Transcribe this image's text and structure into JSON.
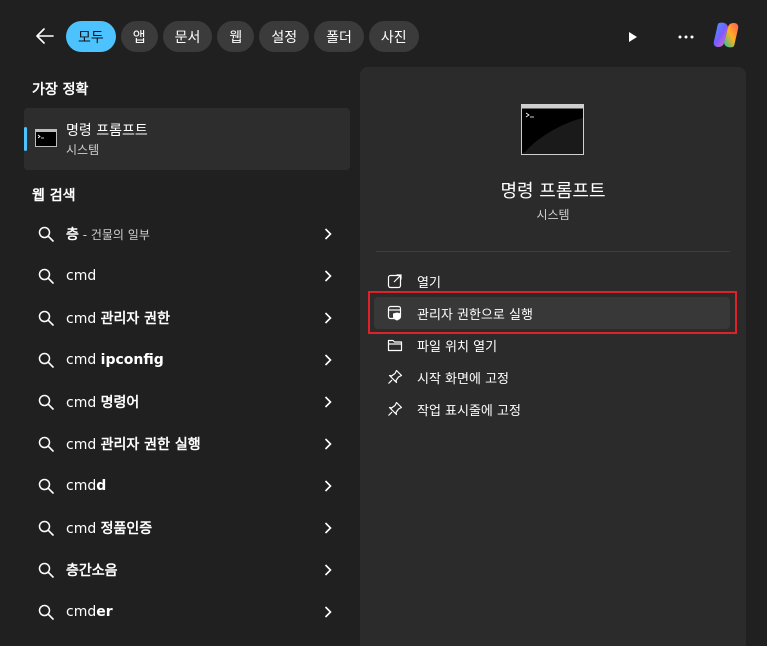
{
  "topbar": {
    "filters": [
      "모두",
      "앱",
      "문서",
      "웹",
      "설정",
      "폴더",
      "사진"
    ],
    "active_filter": "모두"
  },
  "best_match": {
    "heading": "가장 정확",
    "name": "명령 프롬프트",
    "type": "시스템"
  },
  "web_search": {
    "heading": "웹 검색",
    "items": [
      {
        "prefix": "",
        "bold": "층",
        "suffix": " - 건물의 일부"
      },
      {
        "prefix": "cmd",
        "bold": "",
        "suffix": ""
      },
      {
        "prefix": "cmd ",
        "bold": "관리자 권한",
        "suffix": ""
      },
      {
        "prefix": "cmd ",
        "bold": "ipconfig",
        "suffix": ""
      },
      {
        "prefix": "cmd ",
        "bold": "명령어",
        "suffix": ""
      },
      {
        "prefix": "cmd ",
        "bold": "관리자 권한 실행",
        "suffix": ""
      },
      {
        "prefix": "cmd",
        "bold": "d",
        "suffix": ""
      },
      {
        "prefix": "cmd ",
        "bold": "정품인증",
        "suffix": ""
      },
      {
        "prefix": "",
        "bold": "층간소음",
        "suffix": ""
      },
      {
        "prefix": "cmd",
        "bold": "er",
        "suffix": ""
      }
    ]
  },
  "detail": {
    "title": "명령 프롬프트",
    "subtitle": "시스템",
    "actions": [
      {
        "label": "열기",
        "icon": "open-external-icon"
      },
      {
        "label": "관리자 권한으로 실행",
        "icon": "shield-run-icon"
      },
      {
        "label": "파일 위치 열기",
        "icon": "folder-icon"
      },
      {
        "label": "시작 화면에 고정",
        "icon": "pin-icon"
      },
      {
        "label": "작업 표시줄에 고정",
        "icon": "pin-icon"
      }
    ]
  },
  "colors": {
    "accent": "#4cc2ff",
    "background": "#202020",
    "panel": "#2b2b2b",
    "highlight_box": "#e0212a"
  }
}
